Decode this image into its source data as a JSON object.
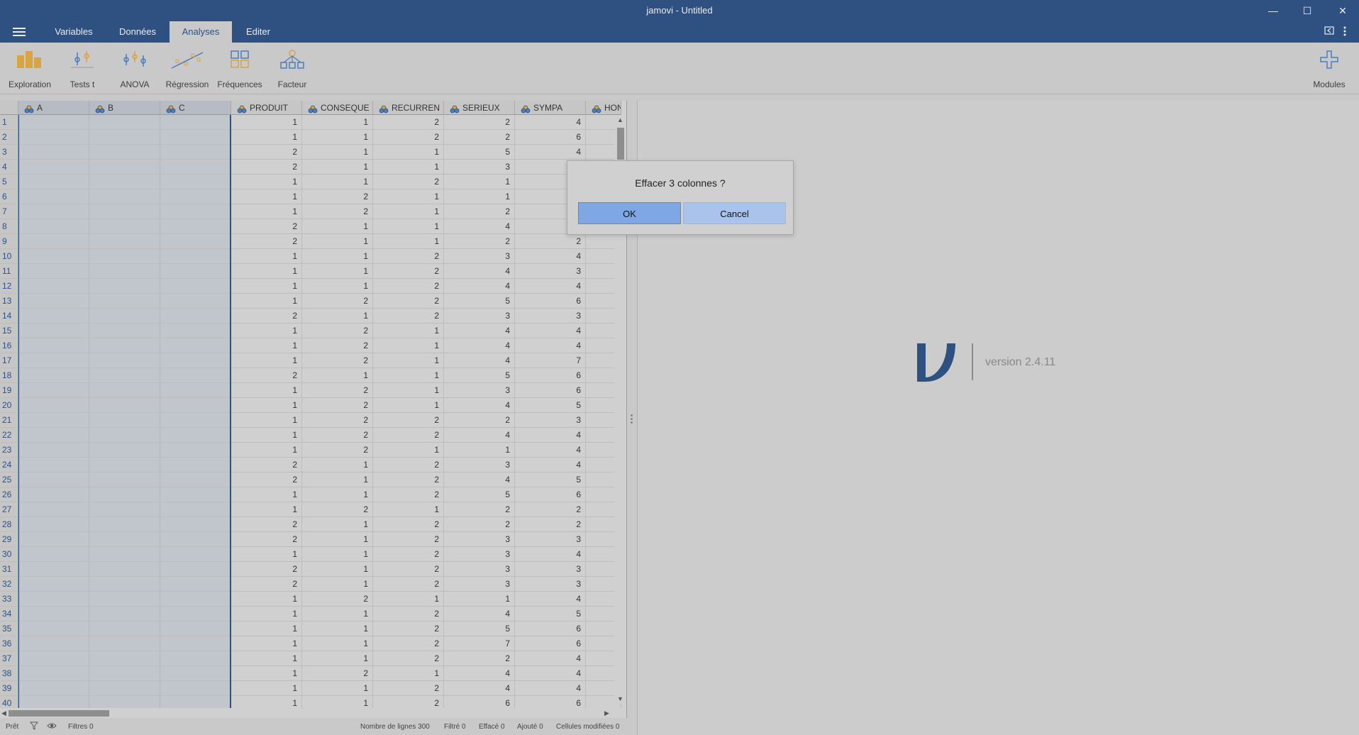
{
  "window": {
    "title": "jamovi - Untitled",
    "minimize": "—",
    "maximize": "☐",
    "close": "✕"
  },
  "tabs": [
    {
      "label": "Variables"
    },
    {
      "label": "Données"
    },
    {
      "label": "Analyses"
    },
    {
      "label": "Editer"
    }
  ],
  "ribbon": {
    "items": [
      {
        "label": "Exploration",
        "icon": "exploration-icon"
      },
      {
        "label": "Tests t",
        "icon": "ttest-icon"
      },
      {
        "label": "ANOVA",
        "icon": "anova-icon"
      },
      {
        "label": "Régression",
        "icon": "regression-icon"
      },
      {
        "label": "Fréquences",
        "icon": "frequencies-icon"
      },
      {
        "label": "Facteur",
        "icon": "factor-icon"
      }
    ],
    "modules_label": "Modules"
  },
  "grid": {
    "columns": [
      "A",
      "B",
      "C",
      "PRODUIT",
      "CONSEQUE",
      "RECURREN",
      "SERIEUX",
      "SYMPA",
      "HONN"
    ],
    "rows": [
      [
        1,
        1,
        2,
        2,
        4
      ],
      [
        1,
        1,
        2,
        2,
        6
      ],
      [
        2,
        1,
        1,
        5,
        4
      ],
      [
        2,
        1,
        1,
        3,
        ""
      ],
      [
        1,
        1,
        2,
        1,
        ""
      ],
      [
        1,
        2,
        1,
        1,
        ""
      ],
      [
        1,
        2,
        1,
        2,
        ""
      ],
      [
        2,
        1,
        1,
        4,
        ""
      ],
      [
        2,
        1,
        1,
        2,
        2
      ],
      [
        1,
        1,
        2,
        3,
        4
      ],
      [
        1,
        1,
        2,
        4,
        3
      ],
      [
        1,
        1,
        2,
        4,
        4
      ],
      [
        1,
        2,
        2,
        5,
        6
      ],
      [
        2,
        1,
        2,
        3,
        3
      ],
      [
        1,
        2,
        1,
        4,
        4
      ],
      [
        1,
        2,
        1,
        4,
        4
      ],
      [
        1,
        2,
        1,
        4,
        7
      ],
      [
        2,
        1,
        1,
        5,
        6
      ],
      [
        1,
        2,
        1,
        3,
        6
      ],
      [
        1,
        2,
        1,
        4,
        5
      ],
      [
        1,
        2,
        2,
        2,
        3
      ],
      [
        1,
        2,
        2,
        4,
        4
      ],
      [
        1,
        2,
        1,
        1,
        4
      ],
      [
        2,
        1,
        2,
        3,
        4
      ],
      [
        2,
        1,
        2,
        4,
        5
      ],
      [
        1,
        1,
        2,
        5,
        6
      ],
      [
        1,
        2,
        1,
        2,
        2
      ],
      [
        2,
        1,
        2,
        2,
        2
      ],
      [
        2,
        1,
        2,
        3,
        3
      ],
      [
        1,
        1,
        2,
        3,
        4
      ],
      [
        2,
        1,
        2,
        3,
        3
      ],
      [
        2,
        1,
        2,
        3,
        3
      ],
      [
        1,
        2,
        1,
        1,
        4
      ],
      [
        1,
        1,
        2,
        4,
        5
      ],
      [
        1,
        1,
        2,
        5,
        6
      ],
      [
        1,
        1,
        2,
        7,
        6
      ],
      [
        1,
        1,
        2,
        2,
        4
      ],
      [
        1,
        2,
        1,
        4,
        4
      ],
      [
        1,
        1,
        2,
        4,
        4
      ],
      [
        1,
        1,
        2,
        6,
        6
      ]
    ]
  },
  "statusbar": {
    "ready": "Prêt",
    "filters": "Filtres 0",
    "row_count": "Nombre de lignes 300",
    "filtered": "Filtré 0",
    "deleted": "Effacé 0",
    "added": "Ajouté 0",
    "modified": "Cellules modifiées 0"
  },
  "results": {
    "version": "version 2.4.11"
  },
  "dialog": {
    "message": "Effacer 3 colonnes ?",
    "ok": "OK",
    "cancel": "Cancel"
  },
  "colors": {
    "brand": "#2e5181",
    "ok_button": "#7ea7e3",
    "cancel_button": "#a9c3ec",
    "icon_orange": "#d9a441",
    "icon_blue": "#4b7dbf"
  }
}
